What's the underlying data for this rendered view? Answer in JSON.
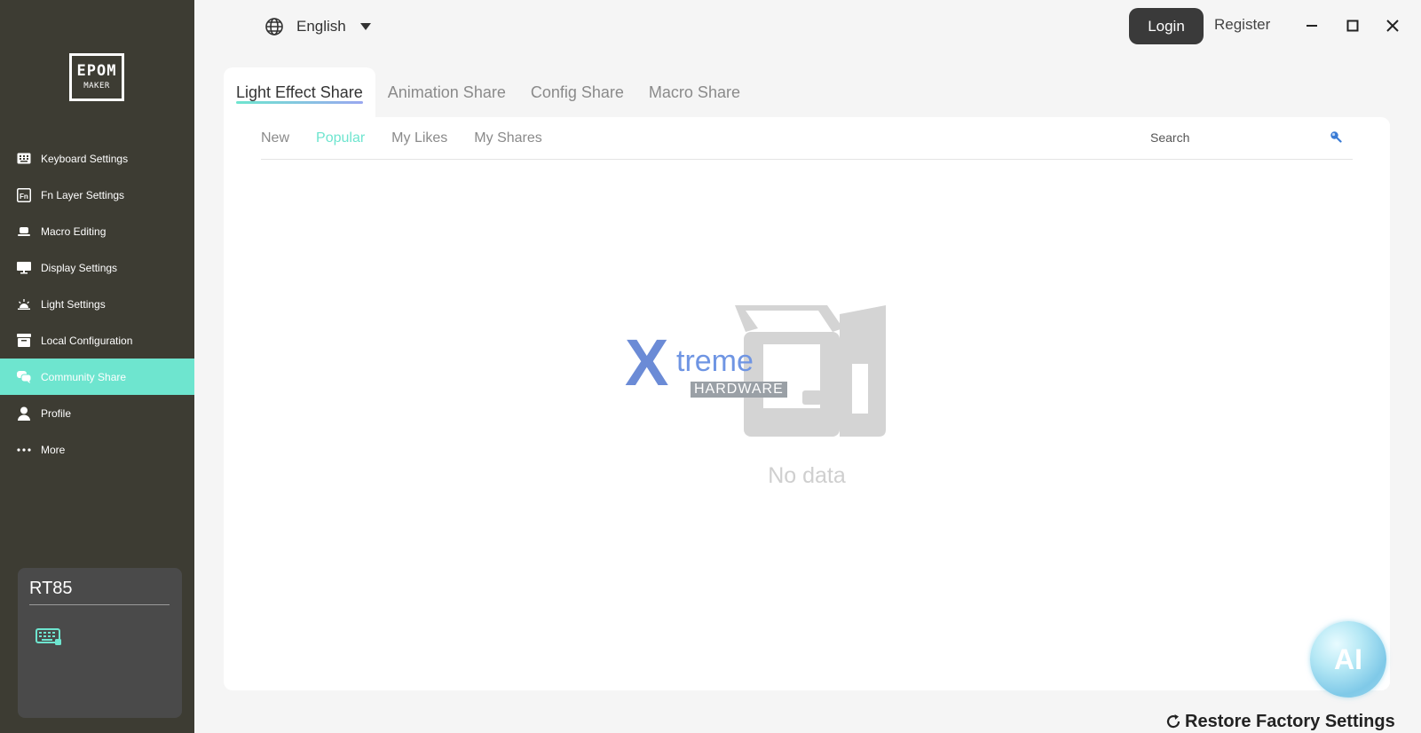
{
  "sidebar": {
    "logo": {
      "line1": "EPOM",
      "line2": "MAKER"
    },
    "items": [
      {
        "label": "Keyboard Settings",
        "icon": "keyboard-icon"
      },
      {
        "label": "Fn Layer Settings",
        "icon": "fn-icon"
      },
      {
        "label": "Macro Editing",
        "icon": "macro-icon"
      },
      {
        "label": "Display Settings",
        "icon": "monitor-icon"
      },
      {
        "label": "Light Settings",
        "icon": "sun-icon"
      },
      {
        "label": "Local Configuration",
        "icon": "archive-icon"
      },
      {
        "label": "Community Share",
        "icon": "chat-icon",
        "active": true
      },
      {
        "label": "Profile",
        "icon": "user-icon"
      },
      {
        "label": "More",
        "icon": "dots-icon"
      }
    ],
    "device": {
      "name": "RT85",
      "icon": "keyboard-icon"
    },
    "active_color": "#6ee5cf"
  },
  "header": {
    "language": "English",
    "login_label": "Login",
    "register_label": "Register"
  },
  "tabs": [
    {
      "label": "Light Effect Share",
      "active": true
    },
    {
      "label": "Animation Share"
    },
    {
      "label": "Config Share"
    },
    {
      "label": "Macro Share"
    }
  ],
  "subtabs": [
    {
      "label": "New"
    },
    {
      "label": "Popular",
      "active": true
    },
    {
      "label": "My Likes"
    },
    {
      "label": "My Shares"
    }
  ],
  "search": {
    "placeholder": "Search"
  },
  "empty": {
    "text": "No data"
  },
  "watermark": {
    "x": "X",
    "treme": "treme",
    "hardware": "HARDWARE"
  },
  "ai_button": {
    "label": "AI"
  },
  "footer": {
    "restore_label": "Restore Factory Settings"
  }
}
